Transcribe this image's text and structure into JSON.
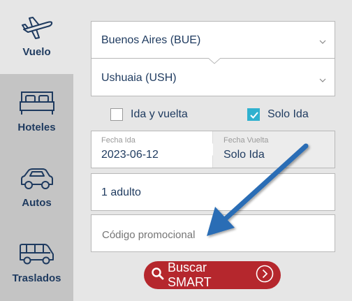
{
  "sidebar": {
    "items": [
      {
        "label": "Vuelo",
        "icon": "airplane-icon",
        "active": true
      },
      {
        "label": "Hoteles",
        "icon": "bed-icon",
        "active": false
      },
      {
        "label": "Autos",
        "icon": "car-icon",
        "active": false
      },
      {
        "label": "Traslados",
        "icon": "van-icon",
        "active": false
      }
    ]
  },
  "form": {
    "origin": "Buenos Aires (BUE)",
    "destination": "Ushuaia (USH)",
    "trip_type": {
      "round_trip_label": "Ida y vuelta",
      "round_trip_checked": false,
      "one_way_label": "Solo Ida",
      "one_way_checked": true
    },
    "depart_label": "Fecha Ida",
    "depart_value": "2023-06-12",
    "return_label": "Fecha Vuelta",
    "return_value": "Solo Ida",
    "passengers": "1 adulto",
    "promo_placeholder": "Código promocional",
    "search_label": "Buscar SMART"
  },
  "colors": {
    "primary_text": "#1e3a5f",
    "accent_check": "#2fb1cf",
    "search_button": "#b5272d",
    "annotation_arrow": "#2a6db5"
  }
}
